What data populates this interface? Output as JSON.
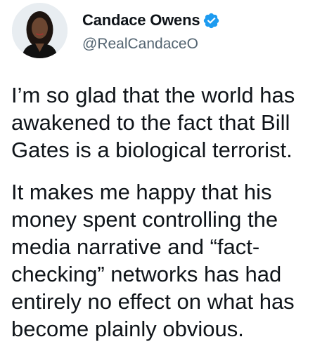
{
  "author": {
    "display_name": "Candace Owens",
    "handle": "@RealCandaceO",
    "verified_icon": "verified-badge-icon",
    "avatar": "avatar-photo"
  },
  "tweet": {
    "paragraphs": [
      "I’m so glad that the world has\nawakened to the fact that Bill\nGates is a biological terrorist.",
      "It makes me happy that his\nmoney spent controlling the\nmedia narrative and “fact-\nchecking” networks has had\nentirely no effect on what has\nbecome plainly obvious."
    ]
  },
  "colors": {
    "text": "#0f1419",
    "handle": "#536471",
    "verified": "#1d9bf0"
  }
}
